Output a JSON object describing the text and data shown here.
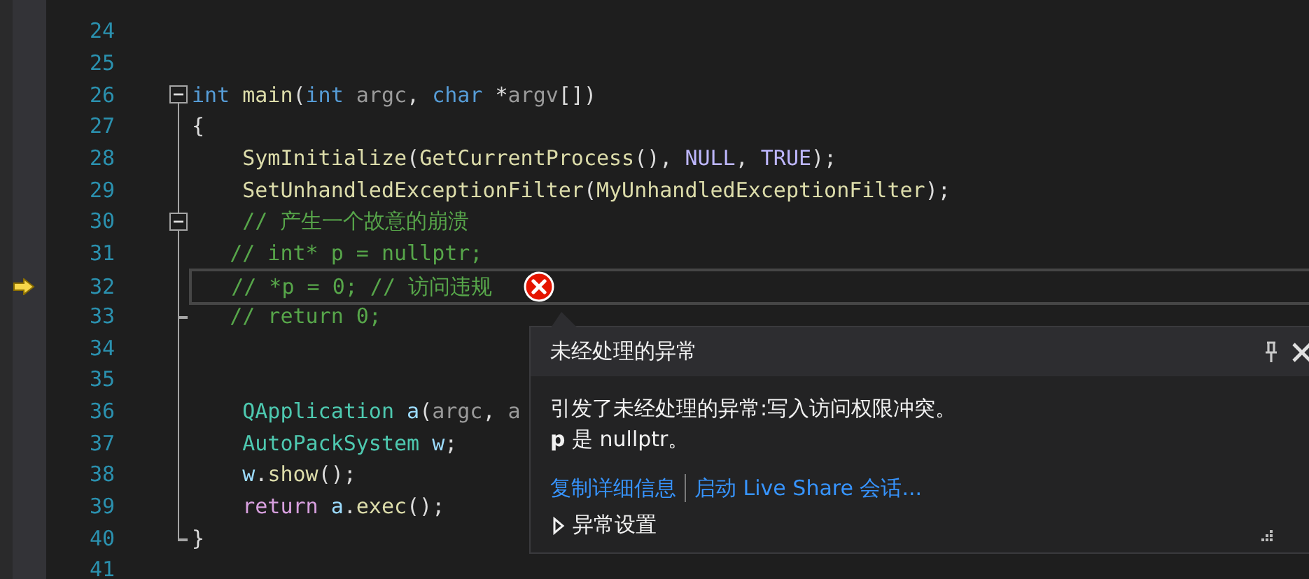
{
  "editor": {
    "lines": [
      {
        "number": "24"
      },
      {
        "number": "25"
      },
      {
        "number": "26",
        "collapsible": true,
        "expanded": true,
        "tokens": [
          {
            "kind": "keyword",
            "text": "int "
          },
          {
            "kind": "function",
            "text": "main"
          },
          {
            "kind": "plain",
            "text": "("
          },
          {
            "kind": "keyword",
            "text": "int "
          },
          {
            "kind": "param",
            "text": "argc"
          },
          {
            "kind": "plain",
            "text": ", "
          },
          {
            "kind": "keyword",
            "text": "char"
          },
          {
            "kind": "plain",
            "text": " *"
          },
          {
            "kind": "param",
            "text": "argv"
          },
          {
            "kind": "plain",
            "text": "[])"
          }
        ]
      },
      {
        "number": "27",
        "tokens": [
          {
            "kind": "plain",
            "text": "{"
          }
        ]
      },
      {
        "number": "28",
        "tokens": [
          {
            "kind": "function",
            "text": "    SymInitialize"
          },
          {
            "kind": "plain",
            "text": "("
          },
          {
            "kind": "function",
            "text": "GetCurrentProcess"
          },
          {
            "kind": "plain",
            "text": "(), "
          },
          {
            "kind": "macro",
            "text": "NULL"
          },
          {
            "kind": "plain",
            "text": ", "
          },
          {
            "kind": "macro",
            "text": "TRUE"
          },
          {
            "kind": "plain",
            "text": ");"
          }
        ]
      },
      {
        "number": "29",
        "tokens": [
          {
            "kind": "function",
            "text": "    SetUnhandledExceptionFilter"
          },
          {
            "kind": "plain",
            "text": "("
          },
          {
            "kind": "function",
            "text": "MyUnhandledExceptionFilter"
          },
          {
            "kind": "plain",
            "text": ");"
          }
        ]
      },
      {
        "number": "30",
        "collapsible": true,
        "expanded": true,
        "tokens": [
          {
            "kind": "comment",
            "text": "    // 产生一个故意的崩溃"
          }
        ]
      },
      {
        "number": "31",
        "tokens": [
          {
            "kind": "comment",
            "text": "   // int* p = nullptr;"
          }
        ]
      },
      {
        "number": "32",
        "current": true,
        "error": true,
        "tokens": [
          {
            "kind": "comment",
            "text": "   // *p = 0; // 访问违规"
          }
        ]
      },
      {
        "number": "33",
        "block_end": true,
        "tokens": [
          {
            "kind": "comment",
            "text": "   // return 0;"
          }
        ]
      },
      {
        "number": "34"
      },
      {
        "number": "35"
      },
      {
        "number": "36",
        "tokens": [
          {
            "kind": "type",
            "text": "    QApplication"
          },
          {
            "kind": "local",
            "text": " a"
          },
          {
            "kind": "plain",
            "text": "("
          },
          {
            "kind": "param",
            "text": "argc"
          },
          {
            "kind": "plain",
            "text": ", "
          },
          {
            "kind": "param",
            "text": "a"
          }
        ]
      },
      {
        "number": "37",
        "tokens": [
          {
            "kind": "type",
            "text": "    AutoPackSystem"
          },
          {
            "kind": "local",
            "text": " w"
          },
          {
            "kind": "plain",
            "text": ";"
          }
        ]
      },
      {
        "number": "38",
        "tokens": [
          {
            "kind": "local",
            "text": "    w"
          },
          {
            "kind": "plain",
            "text": "."
          },
          {
            "kind": "function",
            "text": "show"
          },
          {
            "kind": "plain",
            "text": "();"
          }
        ]
      },
      {
        "number": "39",
        "tokens": [
          {
            "kind": "control",
            "text": "    return "
          },
          {
            "kind": "local",
            "text": "a"
          },
          {
            "kind": "plain",
            "text": "."
          },
          {
            "kind": "function",
            "text": "exec"
          },
          {
            "kind": "plain",
            "text": "();"
          }
        ]
      },
      {
        "number": "40",
        "block_end": true,
        "tokens": [
          {
            "kind": "plain",
            "text": "}"
          }
        ]
      },
      {
        "number": "41"
      }
    ]
  },
  "exception_popup": {
    "title": "未经处理的异常",
    "message": "引发了未经处理的异常:写入访问权限冲突。",
    "detail": "**p** 是 nullptr。",
    "links": [
      "复制详细信息",
      "启动 Live Share 会话..."
    ],
    "settings": {
      "label": "异常设置",
      "expanded": false
    }
  }
}
